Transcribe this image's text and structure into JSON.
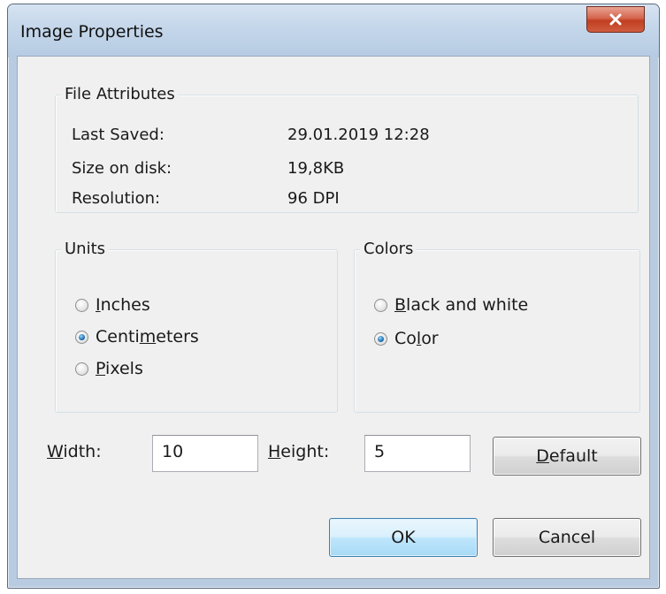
{
  "window": {
    "title": "Image Properties",
    "close_icon": "close-icon"
  },
  "file_attributes": {
    "title": "File Attributes",
    "rows": [
      {
        "label": "Last Saved:",
        "value": "29.01.2019 12:28"
      },
      {
        "label": "Size on disk:",
        "value": "19,8KB"
      },
      {
        "label": "Resolution:",
        "value": "96 DPI"
      }
    ]
  },
  "units": {
    "title": "Units",
    "options": [
      {
        "pre": "",
        "mnemonic": "I",
        "post": "nches",
        "checked": false
      },
      {
        "pre": "Centi",
        "mnemonic": "m",
        "post": "eters",
        "checked": true
      },
      {
        "pre": "",
        "mnemonic": "P",
        "post": "ixels",
        "checked": false
      }
    ]
  },
  "colors": {
    "title": "Colors",
    "options": [
      {
        "pre": "",
        "mnemonic": "B",
        "post": "lack and white",
        "checked": false
      },
      {
        "pre": "Co",
        "mnemonic": "l",
        "post": "or",
        "checked": true
      }
    ]
  },
  "size": {
    "width_label_mnemonic": "W",
    "width_label_rest": "idth:",
    "width_value": "10",
    "height_label_mnemonic": "H",
    "height_label_rest": "eight:",
    "height_value": "5"
  },
  "buttons": {
    "default_mnemonic": "D",
    "default_rest": "efault",
    "ok": "OK",
    "cancel": "Cancel"
  },
  "colors_theme": {
    "frame": "#b8cbe0",
    "client": "#f0f0f0",
    "close": "#c23e22",
    "radio_checked": "#1f6fb2"
  }
}
